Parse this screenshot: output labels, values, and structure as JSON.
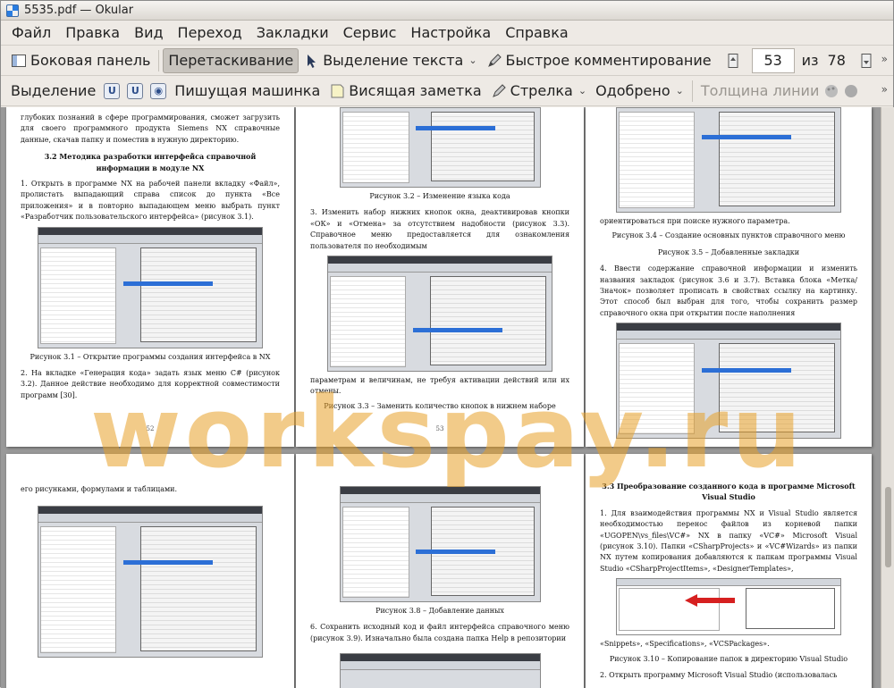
{
  "window": {
    "title": "5535.pdf — Okular"
  },
  "menu": [
    "Файл",
    "Правка",
    "Вид",
    "Переход",
    "Закладки",
    "Сервис",
    "Настройка",
    "Справка"
  ],
  "toolbar": {
    "sidebar": "Боковая панель",
    "drag": "Перетаскивание",
    "text_select": "Выделение текста",
    "quick_comment": "Быстрое комментирование",
    "page_current": "53",
    "page_of": "из",
    "page_total": "78"
  },
  "annot_bar": {
    "selection": "Выделение",
    "typewriter": "Пишущая машинка",
    "sticky_note": "Висящая заметка",
    "arrow": "Стрелка",
    "approved": "Одобрено",
    "line_width": "Толщина линии"
  },
  "pages": {
    "p52": {
      "t1": "глубоких познаний в сфере программирования, сможет загрузить для своего программного продукта Siemens NX справочные данные, скачав папку и поместив в нужную директорию.",
      "h1": "3.2 Методика разработки интерфейса справочной информации в модуле NX",
      "t2": "1. Открыть в программе NX на рабочей панели вкладку «Файл», пролистать выпадающий справа список до пункта «Все приложения» и в повторно выпадающем меню выбрать пункт «Разработчик пользовательского интерфейса» (рисунок 3.1).",
      "c1": "Рисунок 3.1 – Открытие программы создания интерфейса в NX",
      "t3": "2. На вкладке «Генерация кода» задать язык меню C# (рисунок 3.2). Данное действие необходимо для корректной совместимости программ [30].",
      "num": "52"
    },
    "p53": {
      "c1": "Рисунок 3.2 – Изменение языка кода",
      "t1": "3. Изменить набор нижних кнопок окна, деактивировав кнопки «ОК» и «Отмена» за отсутствием надобности (рисунок 3.3). Справочное меню предоставляется для ознакомления пользователя по необходимым",
      "t2": "параметрам и величинам, не требуя активации действий или их отмены.",
      "c2": "Рисунок 3.3 – Заменить количество кнопок в нижнем наборе",
      "num": "53"
    },
    "p54": {
      "t1": "ориентироваться при поиске нужного параметра.",
      "c1": "Рисунок 3.4 – Создание основных пунктов справочного меню",
      "c2": "Рисунок 3.5 – Добавленные закладки",
      "t2": "4. Ввести содержание справочной информации и изменить названия закладок (рисунок 3.6 и 3.7). Вставка блока «Метка/Значок» позволяет прописать в свойствах ссылку на картинку. Этот способ был выбран для того, чтобы сохранить размер справочного окна при открытии после наполнения"
    },
    "p55": {
      "t1": "его рисунками, формулами и таблицами."
    },
    "p56": {
      "c1": "Рисунок 3.8 – Добавление данных",
      "t1": "6. Сохранить исходный код и файл интерфейса справочного меню (рисунок 3.9). Изначально была создана папка Help в репозитории"
    },
    "p57": {
      "h1": "3.3 Преобразование созданного кода в программе Microsoft Visual Studio",
      "t1": "1. Для взаимодействия программы NX и Visual Studio является необходимостью перенос файлов из корневой папки «UGOPEN\\vs_files\\VC#» NX в папку «VC#» Microsoft Visual (рисунок 3.10). Папки «CSharpProjects» и «VC#Wizards» из папки NX путем копирования добавляются к папкам программы Visual Studio «CSharpProjectItems», «DesignerTemplates»,",
      "t2": "«Snippets», «Specifications», «VCSPackages».",
      "c1": "Рисунок 3.10 – Копирование папок в директорию Visual Studio",
      "t3": "2. Открыть программу Microsoft Visual Studio (использовалась"
    }
  },
  "watermark": "workspay.ru",
  "colors": {
    "watermark": "#e8a028",
    "selection_blue": "#2c6fd6"
  }
}
